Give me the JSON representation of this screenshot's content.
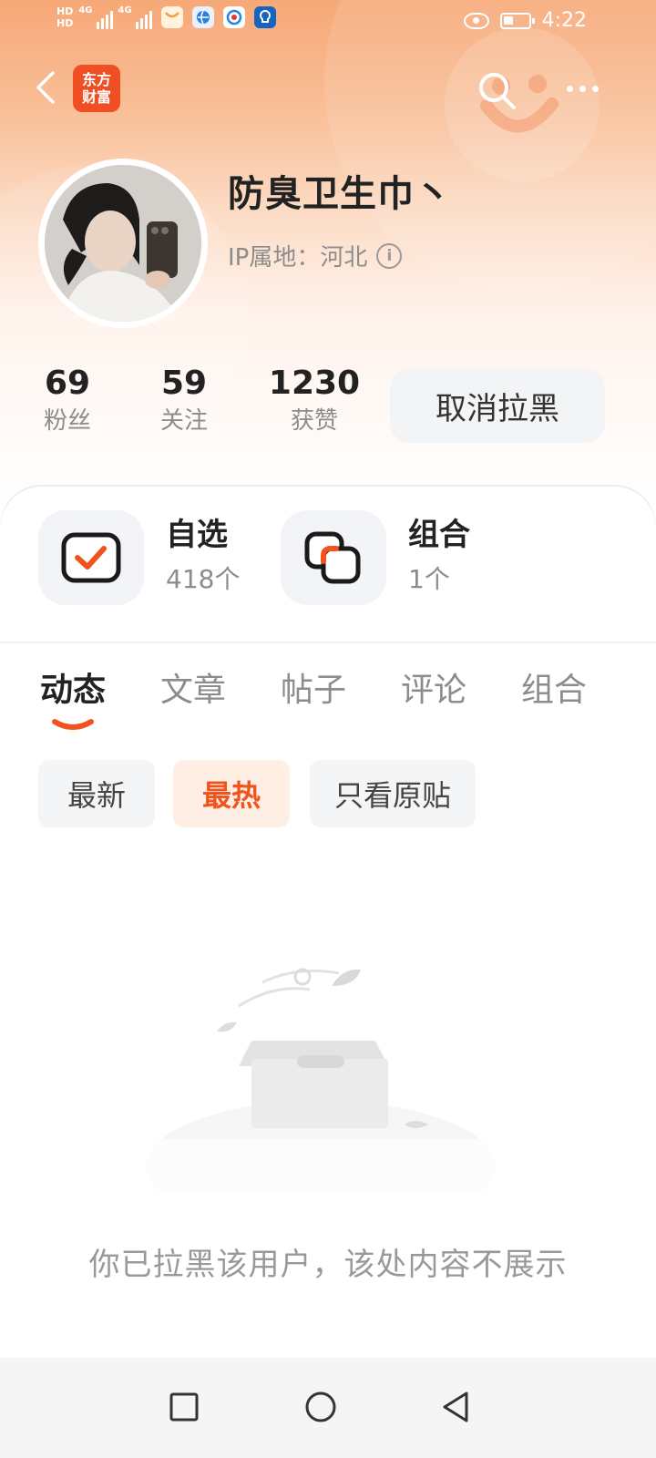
{
  "status_bar": {
    "hd_top": "HD",
    "hd_bottom": "HD",
    "net1": "4G",
    "net2": "4G",
    "time": "4:22"
  },
  "header": {
    "logo_line1": "东方",
    "logo_line2": "财富"
  },
  "profile": {
    "username": "防臭卫生巾丶",
    "ip_location": "IP属地：河北",
    "info_glyph": "i"
  },
  "stats": [
    {
      "value": "69",
      "label": "粉丝"
    },
    {
      "value": "59",
      "label": "关注"
    },
    {
      "value": "1230",
      "label": "获赞"
    }
  ],
  "unblock_button": "取消拉黑",
  "features": [
    {
      "title": "自选",
      "subtitle": "418个"
    },
    {
      "title": "组合",
      "subtitle": "1个"
    }
  ],
  "tabs": [
    "动态",
    "文章",
    "帖子",
    "评论",
    "组合"
  ],
  "active_tab": "动态",
  "filters": [
    "最新",
    "最热",
    "只看原贴"
  ],
  "active_filter": "最热",
  "empty_message": "你已拉黑该用户，该处内容不展示",
  "colors": {
    "accent": "#f0541c",
    "brand_logo": "#f04e23",
    "header_top": "#f7a877"
  },
  "icons": {
    "back": "back-arrow-icon",
    "search": "search-icon",
    "more": "more-dots-icon",
    "watchlist": "checkbox-check-icon",
    "portfolio": "overlapping-squares-icon",
    "nav_recent": "square-icon",
    "nav_home": "circle-icon",
    "nav_back": "triangle-back-icon"
  }
}
